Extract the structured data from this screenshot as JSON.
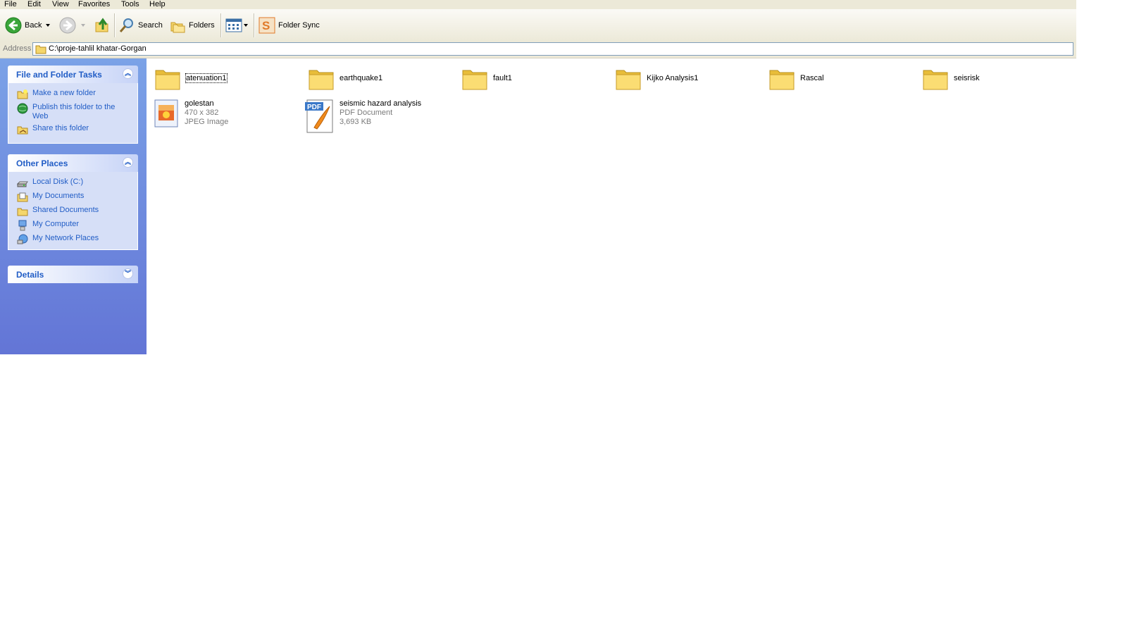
{
  "menu": [
    "File",
    "Edit",
    "View",
    "Favorites",
    "Tools",
    "Help"
  ],
  "toolbar": {
    "back_label": "Back",
    "search_label": "Search",
    "folders_label": "Folders",
    "folder_sync_label": "Folder Sync"
  },
  "address": {
    "label": "Address",
    "path": "C:\\proje-tahlil khatar-Gorgan"
  },
  "tasks_panel": {
    "title": "File and Folder Tasks",
    "items": [
      {
        "label": "Make a new folder",
        "icon": "new-folder-icon"
      },
      {
        "label": "Publish this folder to the Web",
        "icon": "publish-web-icon"
      },
      {
        "label": "Share this folder",
        "icon": "share-folder-icon"
      }
    ]
  },
  "other_places": {
    "title": "Other Places",
    "items": [
      {
        "label": "Local Disk (C:)",
        "icon": "local-disk-icon"
      },
      {
        "label": "My Documents",
        "icon": "my-documents-icon"
      },
      {
        "label": "Shared Documents",
        "icon": "shared-documents-icon"
      },
      {
        "label": "My Computer",
        "icon": "my-computer-icon"
      },
      {
        "label": "My Network Places",
        "icon": "network-places-icon"
      }
    ]
  },
  "details": {
    "title": "Details"
  },
  "folders": [
    "atenuation1",
    "earthquake1",
    "fault1",
    "Kijko Analysis1",
    "Rascal",
    "seisrisk"
  ],
  "files": [
    {
      "name": "golestan",
      "line1": "470 x 382",
      "line2": "JPEG Image",
      "icon": "jpeg-image-icon"
    },
    {
      "name": "seismic hazard analysis",
      "line1": "PDF Document",
      "line2": "3,693 KB",
      "icon": "pdf-document-icon"
    }
  ],
  "colors": {
    "link_blue": "#215dc6",
    "pane_top": "#7ba2e7",
    "pane_bottom": "#6375d6",
    "chrome": "#ece9d8"
  }
}
